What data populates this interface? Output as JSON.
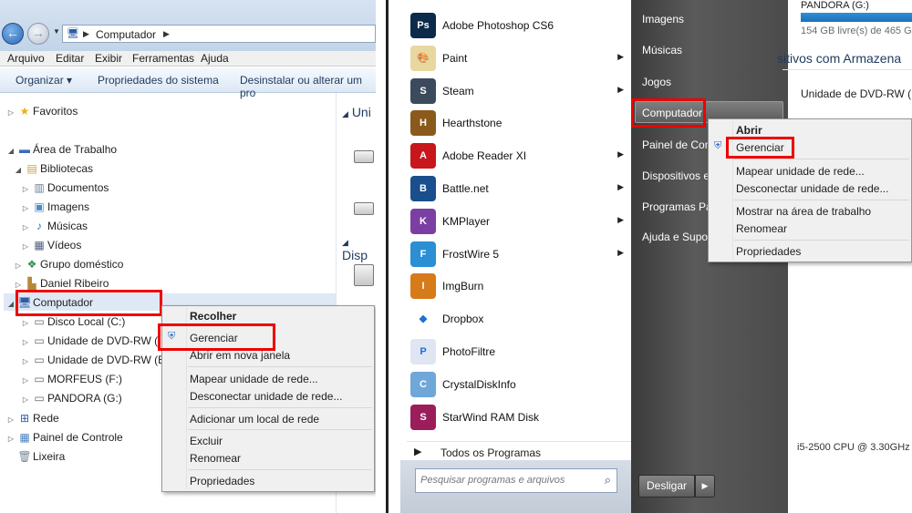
{
  "explorer": {
    "address": {
      "location": "Computador"
    },
    "menubar": [
      "Arquivo",
      "Editar",
      "Exibir",
      "Ferramentas",
      "Ajuda"
    ],
    "commands": {
      "organize": "Organizar ▾",
      "system_props": "Propriedades do sistema",
      "uninstall": "Desinstalar ou alterar um pro"
    },
    "tree": {
      "favorites": "Favoritos",
      "desktop": "Área de Trabalho",
      "libraries": "Bibliotecas",
      "documents": "Documentos",
      "images": "Imagens",
      "music": "Músicas",
      "videos": "Vídeos",
      "homegroup": "Grupo doméstico",
      "user": "Daniel Ribeiro",
      "computer": "Computador",
      "local_disk": "Disco Local (C:)",
      "dvd1": "Unidade de DVD-RW (",
      "dvd2": "Unidade de DVD-RW (E",
      "morfeus": "MORFEUS (F:)",
      "pandora": "PANDORA (G:)",
      "network": "Rede",
      "control_panel": "Painel de Controle",
      "trash": "Lixeira"
    },
    "content_headers": {
      "h1": "Uni",
      "h2": "Disp"
    },
    "context_menu": {
      "collapse": "Recolher",
      "manage": "Gerenciar",
      "open_new_window": "Abrir em nova janela",
      "map_drive": "Mapear unidade de rede...",
      "disconnect_drive": "Desconectar unidade de rede...",
      "add_network_location": "Adicionar um local de rede",
      "delete": "Excluir",
      "rename": "Renomear",
      "properties": "Propriedades"
    }
  },
  "start_menu": {
    "programs": [
      {
        "label": "Adobe Photoshop CS6",
        "icon": "photoshop-icon",
        "color": "#0d2a4a",
        "glyph": "Ps",
        "arrow": false
      },
      {
        "label": "Paint",
        "icon": "paint-icon",
        "color": "#e9d7a0",
        "glyph": "🎨",
        "arrow": true
      },
      {
        "label": "Steam",
        "icon": "steam-icon",
        "color": "#3b4a5c",
        "glyph": "S",
        "arrow": true
      },
      {
        "label": "Hearthstone",
        "icon": "hearthstone-icon",
        "color": "#8a5a1c",
        "glyph": "H",
        "arrow": false
      },
      {
        "label": "Adobe Reader XI",
        "icon": "adobe-reader-icon",
        "color": "#c8161d",
        "glyph": "A",
        "arrow": true
      },
      {
        "label": "Battle.net",
        "icon": "battlenet-icon",
        "color": "#1a4e8c",
        "glyph": "B",
        "arrow": true
      },
      {
        "label": "KMPlayer",
        "icon": "kmplayer-icon",
        "color": "#7b3fa3",
        "glyph": "K",
        "arrow": true
      },
      {
        "label": "FrostWire 5",
        "icon": "frostwire-icon",
        "color": "#2b8fd3",
        "glyph": "F",
        "arrow": true
      },
      {
        "label": "ImgBurn",
        "icon": "imgburn-icon",
        "color": "#d77a1a",
        "glyph": "I",
        "arrow": false
      },
      {
        "label": "Dropbox",
        "icon": "dropbox-icon",
        "color": "#ffffff",
        "glyph": "◆",
        "arrow": false
      },
      {
        "label": "PhotoFiltre",
        "icon": "photofiltre-icon",
        "color": "#dfe6f2",
        "glyph": "P",
        "arrow": false
      },
      {
        "label": "CrystalDiskInfo",
        "icon": "crystaldiskinfo-icon",
        "color": "#6fa7d8",
        "glyph": "C",
        "arrow": false
      },
      {
        "label": "StarWind RAM Disk",
        "icon": "starwind-icon",
        "color": "#9b1e5a",
        "glyph": "S",
        "arrow": false
      }
    ],
    "all_programs": "Todos os Programas",
    "search_placeholder": "Pesquisar programas e arquivos",
    "places": {
      "images": "Imagens",
      "music": "Músicas",
      "games": "Jogos",
      "computer": "Computador",
      "control_panel": "Painel de Cont",
      "devices": "Dispositivos e",
      "default_programs": "Programas Pa",
      "help": "Ajuda e Supor"
    },
    "shutdown": "Desligar",
    "context_menu": {
      "open": "Abrir",
      "manage": "Gerenciar",
      "map_drive": "Mapear unidade de rede...",
      "disconnect_drive": "Desconectar unidade de rede...",
      "show_desktop": "Mostrar na área de trabalho",
      "rename": "Renomear",
      "properties": "Propriedades"
    }
  },
  "background_window": {
    "pandora": "PANDORA (G:)",
    "free_space": "154 GB livre(s) de 465 G",
    "devices_header": "sitivos com Armazena",
    "dvd": "Unidade de DVD-RW (D",
    "cpu": "i5-2500 CPU @ 3.30GHz"
  },
  "colors": {
    "highlight_box": "#e00000",
    "selection": "#dfe9f6"
  }
}
